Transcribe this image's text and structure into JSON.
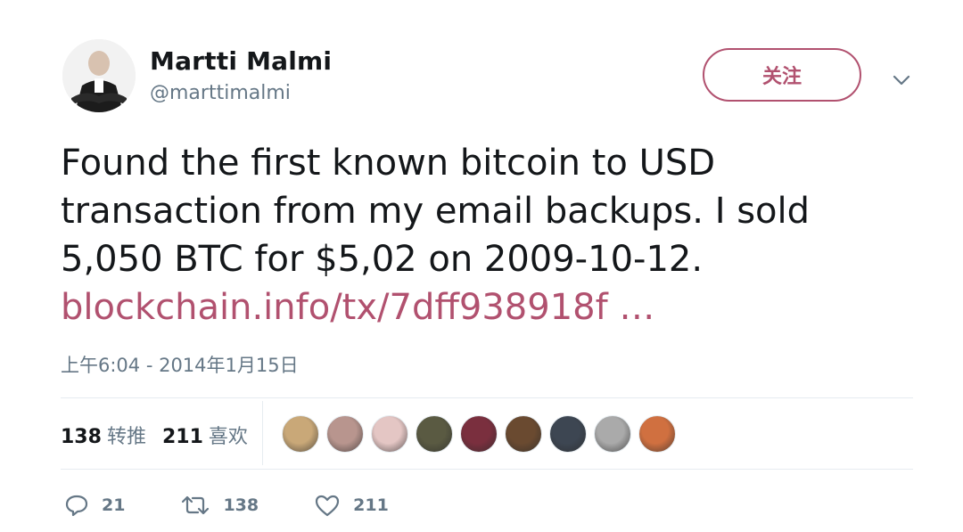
{
  "user": {
    "name": "Martti Malmi",
    "handle": "@marttimalmi"
  },
  "follow_label": "关注",
  "tweet": {
    "lines": [
      "Found the first known bitcoin to USD",
      "transaction from my email backups. I sold",
      "5,050 BTC for $5,02 on 2009-10-12."
    ],
    "link": "blockchain.info/tx/7dff938918f  …"
  },
  "timestamp": "上午6:04 - 2014年1月15日",
  "stats": {
    "retweets_count": "138",
    "retweets_label": "转推",
    "likes_count": "211",
    "likes_label": "喜欢"
  },
  "liker_colors": [
    "#c9a878",
    "#b8958e",
    "#e4c6c4",
    "#5a5a42",
    "#7a2f3e",
    "#6a4a30",
    "#3d4652",
    "#aaaaaa",
    "#d07040"
  ],
  "actions": {
    "reply_count": "21",
    "retweet_count": "138",
    "like_count": "211"
  },
  "colors": {
    "accent": "#b1516f",
    "secondary_text": "#657786",
    "primary_text": "#14171a"
  }
}
